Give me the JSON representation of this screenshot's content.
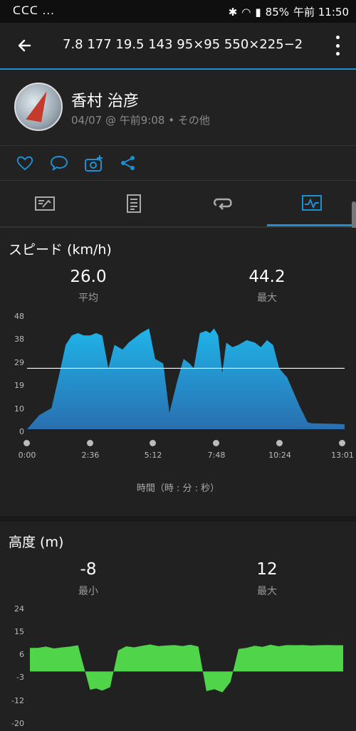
{
  "status_bar": {
    "left": "ᑕᑕᑕ ...",
    "battery": "85%",
    "time": "午前 11:50"
  },
  "header": {
    "title": "7.8  177  19.5  143  95×95  550×225−2"
  },
  "profile": {
    "name": "香村 治彦",
    "meta": "04/07 @ 午前9:08 • その他"
  },
  "speed": {
    "title": "スピード (km/h)",
    "avg_value": "26.0",
    "avg_label": "平均",
    "max_value": "44.2",
    "max_label": "最大",
    "caption": "時間（時 : 分 : 秒）"
  },
  "altitude": {
    "title": "高度 (m)",
    "min_value": "-8",
    "min_label": "最小",
    "max_value": "12",
    "max_label": "最大"
  },
  "colors": {
    "accent": "#1e8fd3",
    "speed_fill_top": "#1fb4e8",
    "speed_fill_bottom": "#2a6fb0",
    "altitude_fill": "#4fd44a"
  },
  "chart_data": [
    {
      "type": "area",
      "title": "スピード (km/h)",
      "xlabel": "時間（時 : 分 : 秒）",
      "ylabel": "",
      "y_ticks": [
        "48",
        "38",
        "29",
        "19",
        "10",
        "0"
      ],
      "ylim": [
        0,
        48
      ],
      "x_ticks": [
        "0:00",
        "2:36",
        "5:12",
        "7:48",
        "10:24",
        "13:01"
      ],
      "xlim_seconds": [
        0,
        781
      ],
      "average_line": 26.0,
      "x": [
        0,
        30,
        60,
        80,
        95,
        110,
        125,
        140,
        155,
        170,
        185,
        200,
        215,
        235,
        250,
        265,
        280,
        300,
        315,
        335,
        350,
        370,
        385,
        400,
        410,
        425,
        440,
        450,
        460,
        470,
        480,
        490,
        505,
        520,
        540,
        560,
        575,
        590,
        605,
        620,
        640,
        655,
        670,
        690,
        700,
        710,
        730,
        750,
        770,
        781
      ],
      "y": [
        0,
        6,
        9,
        24,
        36,
        40,
        41,
        40,
        40,
        41,
        40,
        26,
        36,
        34,
        37,
        39,
        41,
        43,
        30,
        28,
        7,
        21,
        30,
        28,
        26,
        41,
        42,
        41,
        43,
        40,
        24,
        37,
        35,
        36,
        38,
        37,
        35,
        38,
        36,
        26,
        22,
        16,
        10,
        3,
        2.5,
        2.5,
        2.4,
        2.3,
        2.2,
        2.1
      ]
    },
    {
      "type": "area",
      "title": "高度 (m)",
      "y_ticks": [
        "24",
        "15",
        "6",
        "-3",
        "-12",
        "-20"
      ],
      "ylim": [
        -20,
        24
      ],
      "x": [
        0,
        20,
        40,
        60,
        80,
        100,
        120,
        150,
        165,
        180,
        200,
        220,
        240,
        260,
        280,
        300,
        320,
        340,
        360,
        380,
        400,
        420,
        440,
        460,
        480,
        500,
        520,
        540,
        560,
        580,
        600,
        620,
        640,
        660,
        680,
        700,
        720,
        740,
        760,
        781
      ],
      "y": [
        9,
        9,
        9.5,
        8.8,
        9.2,
        9.5,
        10,
        -7,
        -6.5,
        -7.3,
        -6,
        8,
        9.6,
        9.2,
        9.8,
        10.3,
        9.7,
        9.9,
        10.1,
        9.7,
        10.2,
        9.5,
        -7.5,
        -6.8,
        -8,
        -4,
        8.6,
        9,
        9.8,
        9.4,
        10.2,
        9.6,
        10.1,
        10,
        10.1,
        9.9,
        10,
        10.1,
        10,
        10
      ]
    }
  ]
}
